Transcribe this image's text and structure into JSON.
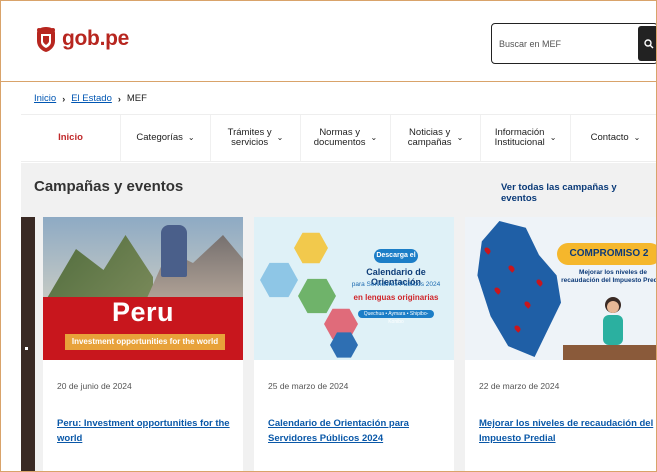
{
  "header": {
    "logo_text": "gob.pe",
    "search_placeholder": "Buscar en MEF",
    "search_icon": "search-icon"
  },
  "breadcrumb": {
    "items": [
      "Inicio",
      "El Estado"
    ],
    "current": "MEF"
  },
  "nav": {
    "items": [
      {
        "label": "Inicio",
        "chevron": false
      },
      {
        "label": "Categorías",
        "chevron": true
      },
      {
        "label": "Trámites y\nservicios",
        "chevron": true
      },
      {
        "label": "Normas y\ndocumentos",
        "chevron": true
      },
      {
        "label": "Noticias y\ncampañas",
        "chevron": true
      },
      {
        "label": "Información\nInstitucional",
        "chevron": true
      },
      {
        "label": "Contacto",
        "chevron": true
      }
    ]
  },
  "section": {
    "title": "Campañas y eventos",
    "see_all": "Ver todas las campañas y eventos"
  },
  "cards": [
    {
      "date": "20 de junio de 2024",
      "title": "Peru: Investment opportunities for the world",
      "image_text_main": "Peru",
      "image_text_bar": "Investment opportunities for the world"
    },
    {
      "date": "25 de marzo de 2024",
      "title": "Calendario de Orientación para Servidores Públicos 2024",
      "image_pill": "Descarga el",
      "image_title": "Calendario de Orientación",
      "image_sub": "para Servidores Públicos 2024",
      "image_red": "en lenguas originarias",
      "image_strip": "Quechua • Aymara • Shipibo-Konibo"
    },
    {
      "date": "22 de marzo de 2024",
      "title": "Mejorar los niveles de recaudación del Impuesto Predial",
      "image_badge": "COMPROMISO 2",
      "image_sub": "Mejorar los niveles de recaudación del Impuesto Predial"
    }
  ],
  "colors": {
    "brand_red": "#c0282a",
    "link_blue": "#0a58a8",
    "section_bg": "#f1f1f1"
  }
}
